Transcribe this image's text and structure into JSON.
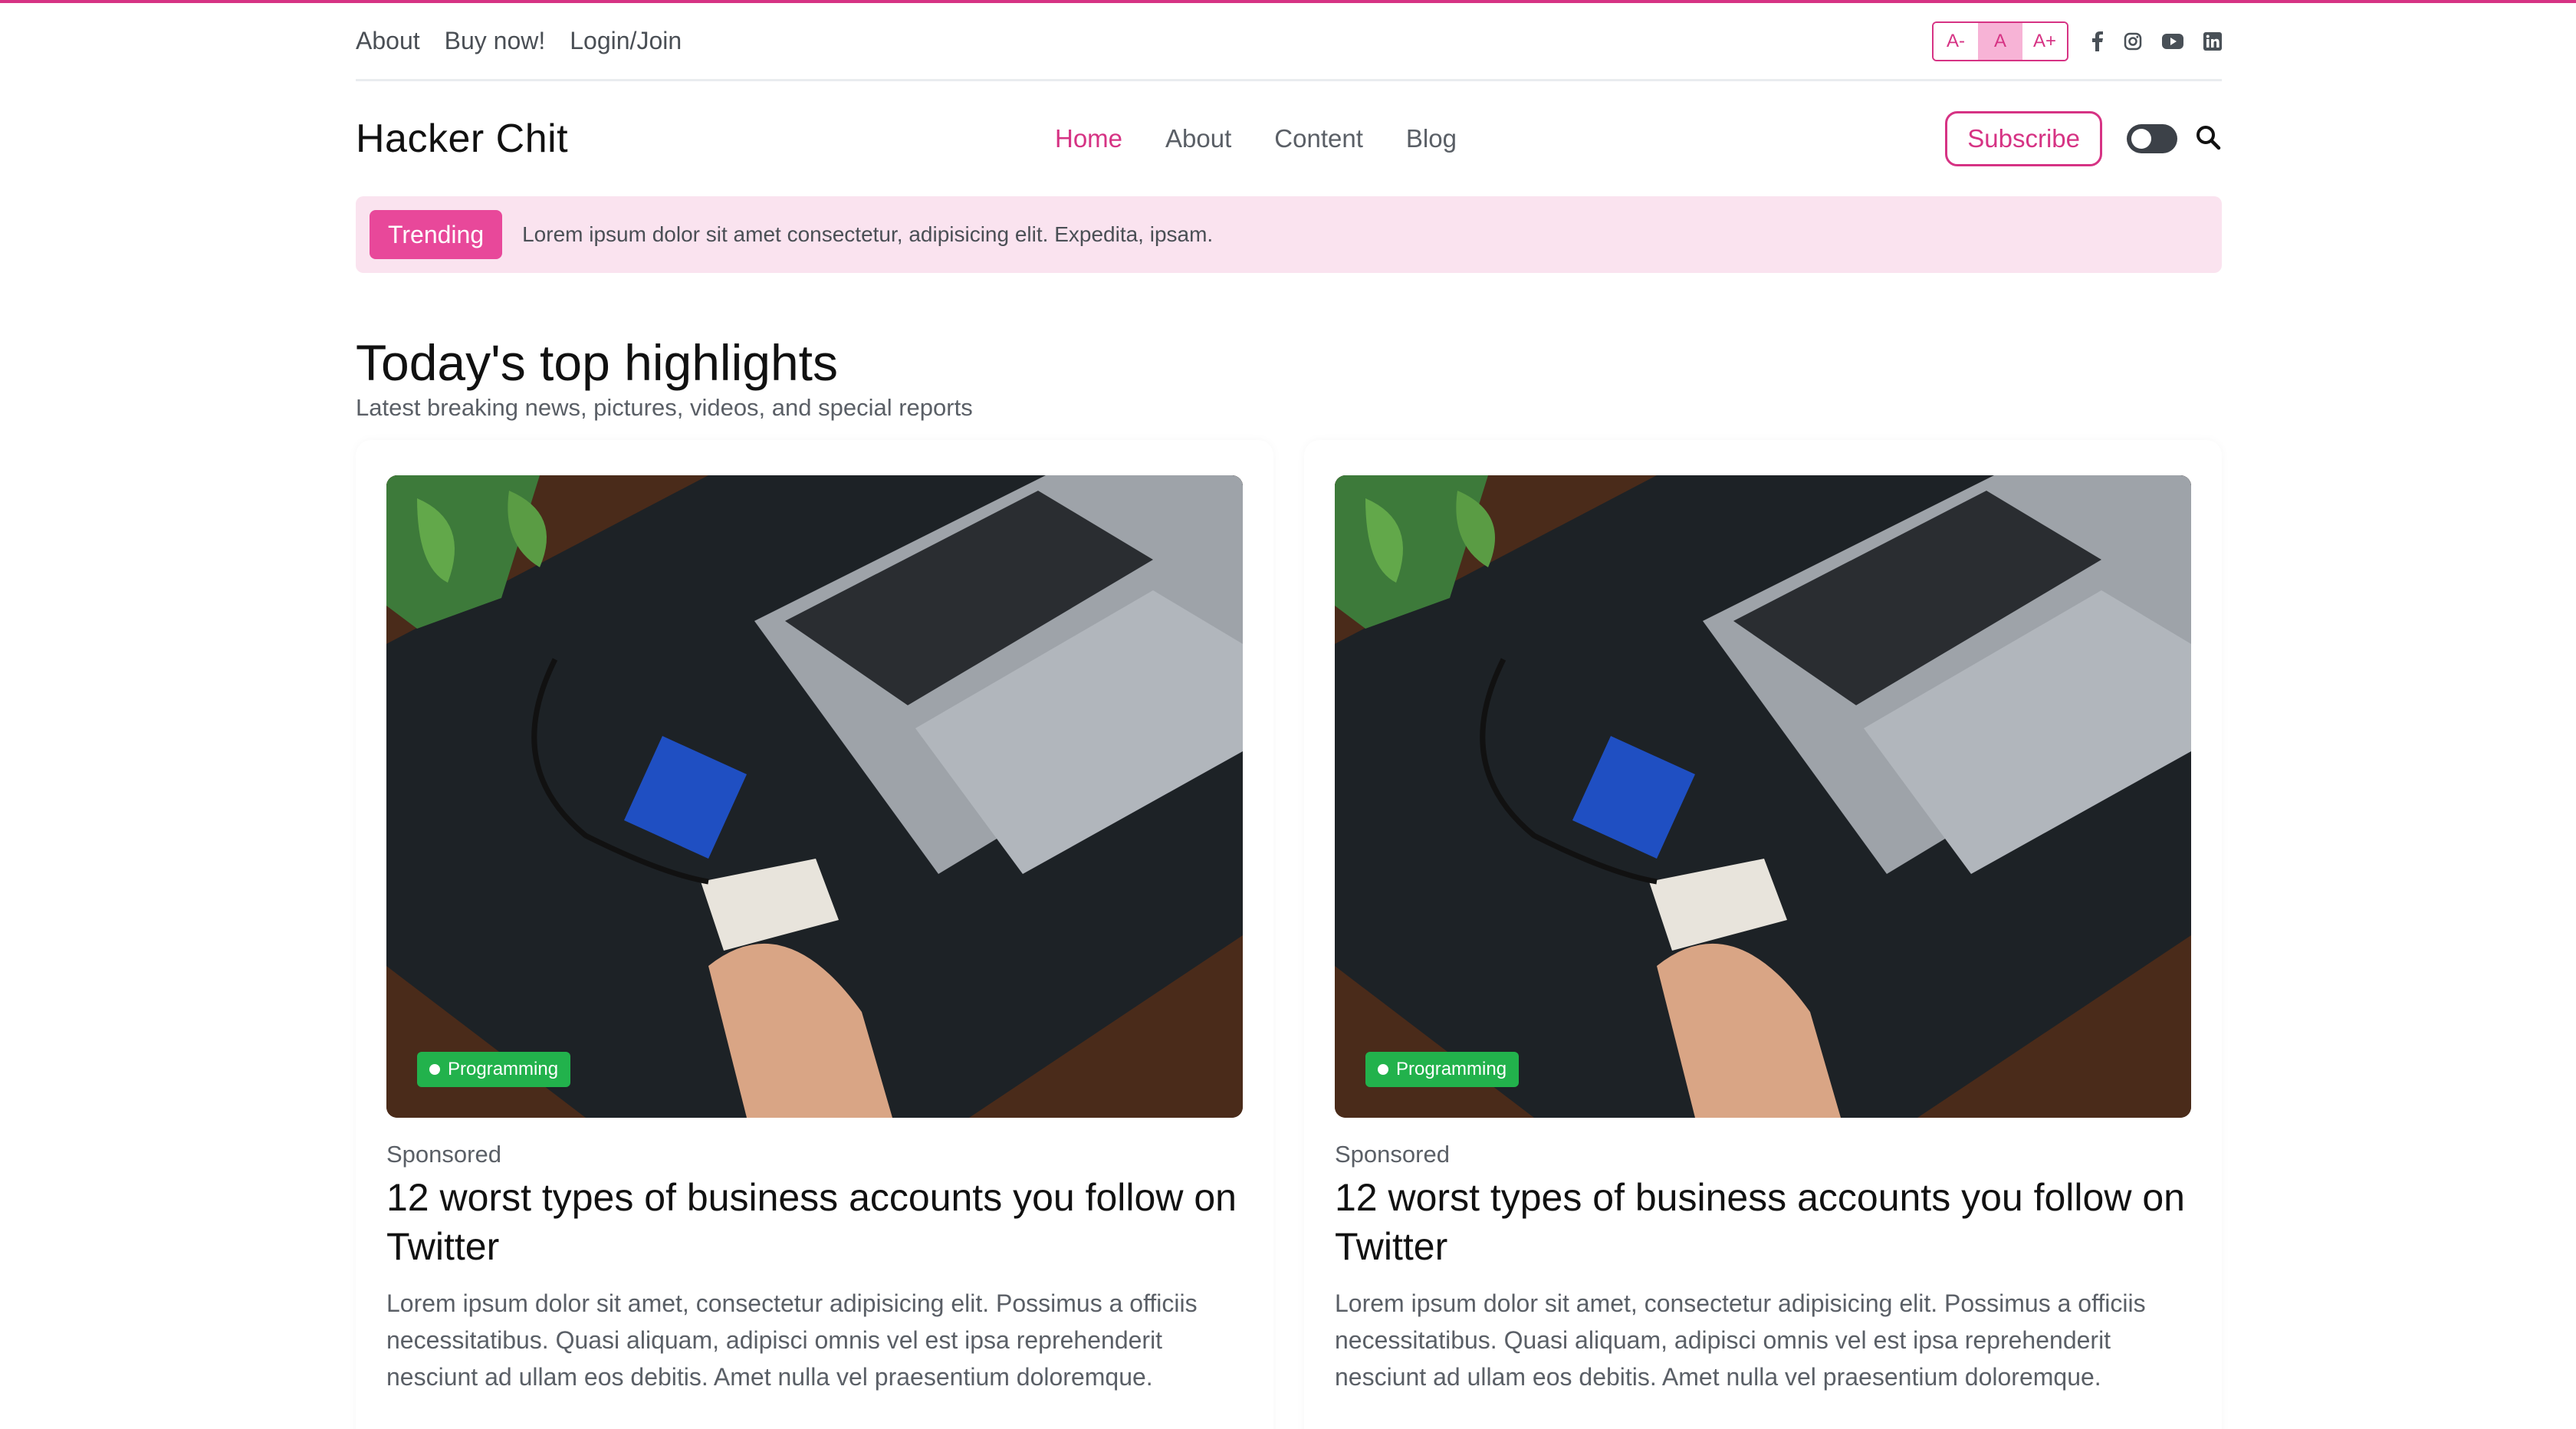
{
  "top_links": [
    "About",
    "Buy now!",
    "Login/Join"
  ],
  "font_size": {
    "decrease": "A-",
    "normal": "A",
    "increase": "A+"
  },
  "social_icons": [
    "facebook-icon",
    "instagram-icon",
    "youtube-icon",
    "linkedin-icon"
  ],
  "brand": "Hacker Chit",
  "nav": {
    "home": "Home",
    "about": "About",
    "content": "Content",
    "blog": "Blog"
  },
  "subscribe_label": "Subscribe",
  "trending": {
    "badge": "Trending",
    "text": "Lorem ipsum dolor sit amet consectetur, adipisicing elit. Expedita, ipsam."
  },
  "section": {
    "title": "Today's top highlights",
    "subtitle": "Latest breaking news, pictures, videos, and special reports"
  },
  "cards": [
    {
      "category": "Programming",
      "label": "Sponsored",
      "title": "12 worst types of business accounts you follow on Twitter",
      "text": "Lorem ipsum dolor sit amet, consectetur adipisicing elit. Possimus a officiis necessitatibus. Quasi aliquam, adipisci omnis vel est ipsa reprehenderit nesciunt ad ullam eos debitis. Amet nulla vel praesentium doloremque."
    },
    {
      "category": "Programming",
      "label": "Sponsored",
      "title": "12 worst types of business accounts you follow on Twitter",
      "text": "Lorem ipsum dolor sit amet, consectetur adipisicing elit. Possimus a officiis necessitatibus. Quasi aliquam, adipisci omnis vel est ipsa reprehenderit nesciunt ad ullam eos debitis. Amet nulla vel praesentium doloremque."
    }
  ],
  "colors": {
    "accent": "#d63384",
    "trending_bg": "#fae3ef",
    "badge_green": "#22b24c"
  }
}
